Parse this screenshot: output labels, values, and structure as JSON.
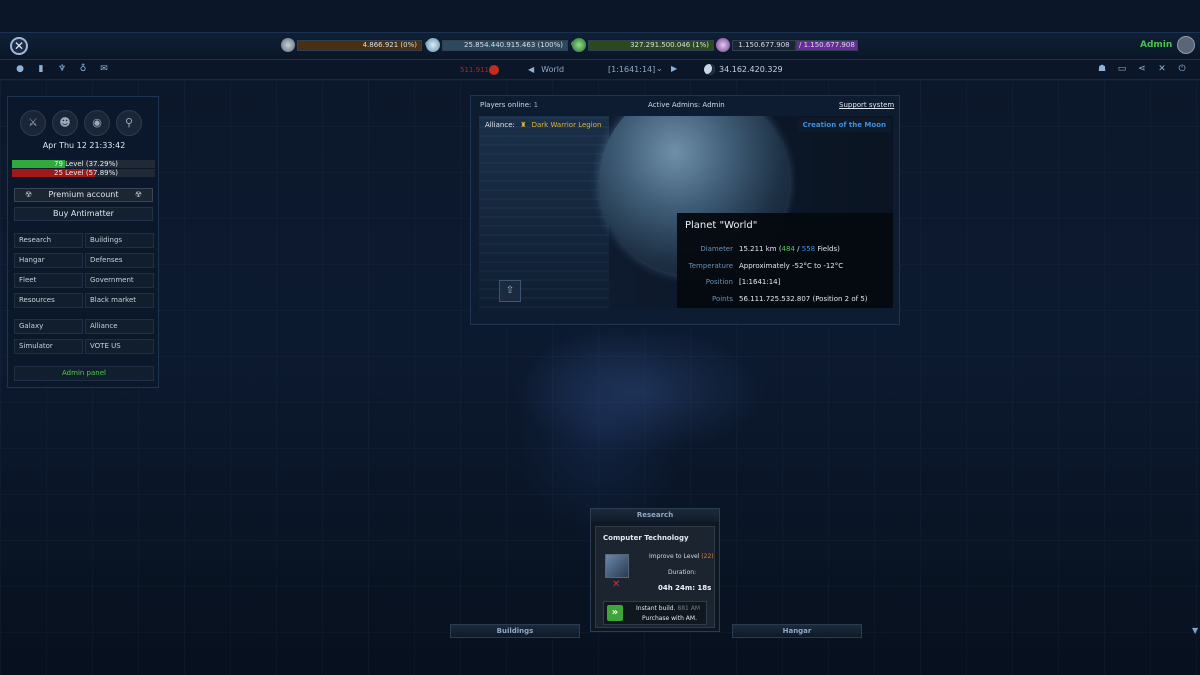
{
  "resources": [
    {
      "name": "metal",
      "value": "4.866.921 (0%)",
      "color": "#a86b20"
    },
    {
      "name": "crystal",
      "value": "25.854.440.915.463 (100%)",
      "color": "#4a7a9a"
    },
    {
      "name": "deuterium",
      "value": "327.291.500.046 (1%)",
      "color": "#4a9a3a"
    },
    {
      "name": "energy",
      "value": "1.150.677.908",
      "max": "/ 1.150.677.908",
      "color": "#8a3aaa"
    }
  ],
  "user": {
    "name": "Admin"
  },
  "darkmatter": "511.911",
  "planet_nav": {
    "name": "World",
    "coords": "[1:1641:14]"
  },
  "top_points": "34.162.420.329",
  "left": {
    "date": "Apr Thu 12 21:33:42",
    "level1": {
      "text": "79 Level (37.29%)",
      "pct": 37.29,
      "color": "#2faa3c"
    },
    "level2": {
      "text": "25 Level (57.89%)",
      "pct": 57.89,
      "color": "#a01818"
    },
    "premium": "Premium account",
    "buy_am": "Buy Antimatter",
    "menu1": [
      "Research",
      "Buildings",
      "Hangar",
      "Defenses",
      "Fleet",
      "Government",
      "Resources",
      "Black market"
    ],
    "menu2": [
      "Galaxy",
      "Alliance",
      "Simulator",
      "VOTE US"
    ],
    "admin_panel": "Admin panel"
  },
  "center": {
    "players_online_label": "Players online:",
    "players_online": "1",
    "active_admins": "Active Admins: Admin",
    "support": "Support system",
    "alliance_label": "Alliance:",
    "alliance_name": "Dark Warrior Legion",
    "moon_link": "Creation of the Moon",
    "planet_title": "Planet \"World\"",
    "diameter_label": "Diameter",
    "diameter_km": "15.211 km (",
    "fields_used": "484",
    "fields_sep": " / ",
    "fields_total": "558",
    "fields_suffix": " Fields)",
    "temperature_label": "Temperature",
    "temperature": "Approximately -52°C to -12°C",
    "position_label": "Position",
    "position": "[1:1641:14]",
    "points_label": "Points",
    "points": "56.111.725.532.807 (Position 2 of 5)"
  },
  "queue": {
    "header": "Research",
    "title": "Computer Technology",
    "improve": "Improve to Level",
    "level": "(22)",
    "duration_label": "Duration:",
    "duration": "04h 24m: 18s",
    "instant": "Instant build.",
    "cost": "881 AM",
    "purchase": "Purchase with AM."
  },
  "tabs": {
    "buildings": "Buildings",
    "hangar": "Hangar"
  }
}
